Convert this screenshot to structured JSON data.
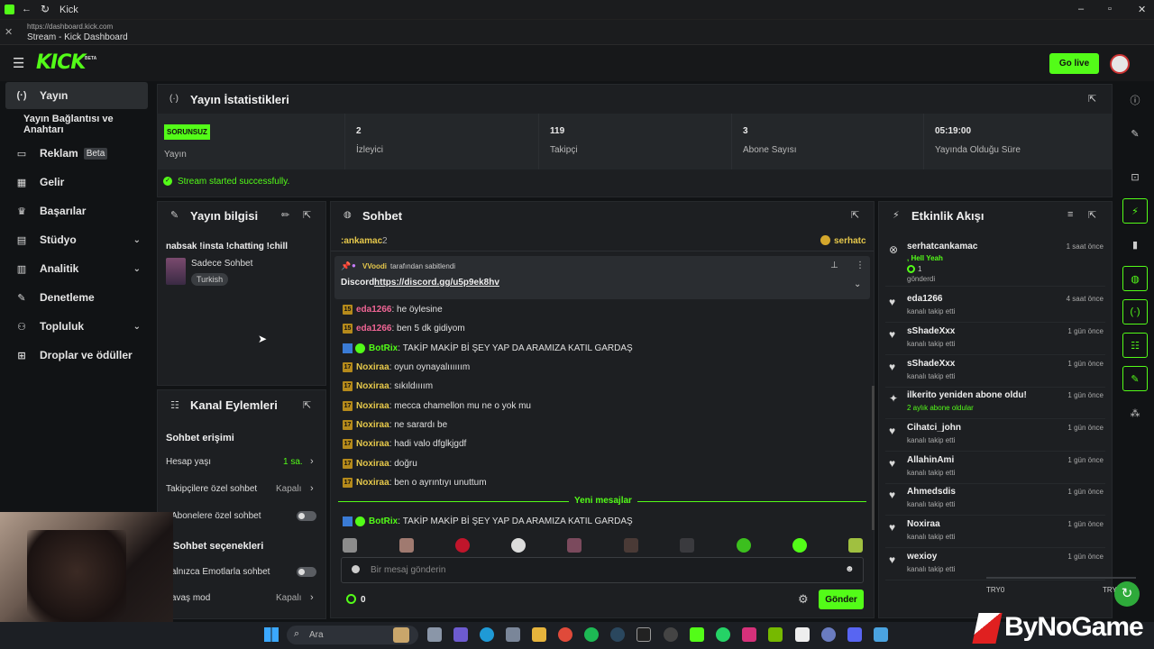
{
  "window": {
    "title": "Kick",
    "url": "https://dashboard.kick.com",
    "page_title": "Stream - Kick Dashboard"
  },
  "header": {
    "logo": "KICK",
    "logo_sup": "BETA",
    "go_live": "Go live"
  },
  "sidebar": {
    "items": [
      {
        "label": "Yayın"
      },
      {
        "label": "Yayın Bağlantısı ve Anahtarı"
      },
      {
        "label": "Reklam",
        "badge": "Beta"
      },
      {
        "label": "Gelir"
      },
      {
        "label": "Başarılar"
      },
      {
        "label": "Stüdyo"
      },
      {
        "label": "Analitik"
      },
      {
        "label": "Denetleme"
      },
      {
        "label": "Topluluk"
      },
      {
        "label": "Droplar ve ödüller"
      }
    ]
  },
  "stats": {
    "title": "Yayın İstatistikleri",
    "status_badge": "SORUNSUZ",
    "status_label": "Yayın",
    "viewers": "2",
    "viewers_label": "İzleyici",
    "followers": "119",
    "followers_label": "Takipçi",
    "subs": "3",
    "subs_label": "Abone Sayısı",
    "uptime": "05:19:00",
    "uptime_label": "Yayında Olduğu Süre",
    "message": "Stream started successfully."
  },
  "stream_info": {
    "title": "Yayın bilgisi",
    "stream_title": "nabsak !insta !chatting !chill",
    "category": "Sadece Sohbet",
    "language": "Turkish"
  },
  "channel_actions": {
    "title": "Kanal Eylemleri",
    "chat_access": "Sohbet erişimi",
    "account_age": "Hesap yaşı",
    "account_age_value": "1 sa.",
    "followers_only": "Takipçilere özel sohbet",
    "followers_only_value": "Kapalı",
    "subs_only": "Abonelere özel sohbet",
    "chat_options": "Sohbet seçenekleri",
    "emotes_only": "Yalnızca Emotlarla sohbet",
    "slow_mode": "Yavaş mod",
    "slow_mode_value": "Kapalı"
  },
  "chat": {
    "title": "Sohbet",
    "top_user": ":ankamac",
    "top_count": "2",
    "top_right": "serhatc",
    "pinned_by_name": "VVoodi",
    "pinned_by_suffix": "tarafından sabitlendi",
    "pinned_text": "Discord",
    "pinned_link": "https://discord.gg/u5p9ek8hv",
    "messages": [
      {
        "badge": "15",
        "user": "eda1266",
        "text": "he öylesine"
      },
      {
        "badge": "15",
        "user": "eda1266",
        "text": "ben 5 dk gidiyom"
      },
      {
        "badge": "",
        "user": "BotRix",
        "text": "TAKİP MAKİP Bİ ŞEY YAP DA ARAMIZA KATIL GARDAŞ"
      },
      {
        "badge": "17",
        "user": "Noxiraa",
        "text": "oyun oynayalıııııım"
      },
      {
        "badge": "17",
        "user": "Noxiraa",
        "text": "sıkıldıııım"
      },
      {
        "badge": "17",
        "user": "Noxiraa",
        "text": "mecca chamellon mu ne o yok mu"
      },
      {
        "badge": "17",
        "user": "Noxiraa",
        "text": "ne sarardı be"
      },
      {
        "badge": "17",
        "user": "Noxiraa",
        "text": "hadi valo dfglkjgdf"
      },
      {
        "badge": "17",
        "user": "Noxiraa",
        "text": "doğru"
      },
      {
        "badge": "17",
        "user": "Noxiraa",
        "text": "ben o ayrıntıyı unuttum"
      }
    ],
    "new_messages": "Yeni mesajlar",
    "after_new": {
      "user": "BotRix",
      "text": "TAKİP MAKİP Bİ ŞEY YAP DA ARAMIZA KATIL GARDAŞ"
    },
    "input_placeholder": "Bir mesaj gönderin",
    "points": "0",
    "send": "Gönder"
  },
  "events": {
    "title": "Etkinlik Akışı",
    "items": [
      {
        "name": "serhatcankamac",
        "sub": "gönderdi",
        "time": "1 saat önce"
      },
      {
        "name": "eda1266",
        "sub": "kanalı takip etti",
        "time": "4 saat önce"
      },
      {
        "name": "sShadeXxx",
        "sub": "kanalı takip etti",
        "time": "1 gün önce"
      },
      {
        "name": "sShadeXxx",
        "sub": "kanalı takip etti",
        "time": "1 gün önce"
      },
      {
        "name": "ilkerito yeniden abone oldu!",
        "sub": "2 aylık abone oldular",
        "time": "1 gün önce"
      },
      {
        "name": "Cihatci_john",
        "sub": "kanalı takip etti",
        "time": "1 gün önce"
      },
      {
        "name": "AllahinAmi",
        "sub": "kanalı takip etti",
        "time": "1 gün önce"
      },
      {
        "name": "Ahmedsdis",
        "sub": "kanalı takip etti",
        "time": "1 gün önce"
      },
      {
        "name": "Noxiraa",
        "sub": "kanalı takip etti",
        "time": "1 gün önce"
      },
      {
        "name": "wexioy",
        "sub": "kanalı takip etti",
        "time": "1 gün önce"
      }
    ],
    "first_extra": ", Hell Yeah",
    "first_count": "1"
  },
  "taskbar": {
    "search": "Ara"
  },
  "overlay": {
    "try_left": "TRY0",
    "try_right": "TRY",
    "brand": "ByNoGame"
  },
  "colors": {
    "accent": "#53fc18",
    "username_pink": "#f06595",
    "username_yellow": "#e6c84b",
    "botrix_green": "#53fc18"
  }
}
